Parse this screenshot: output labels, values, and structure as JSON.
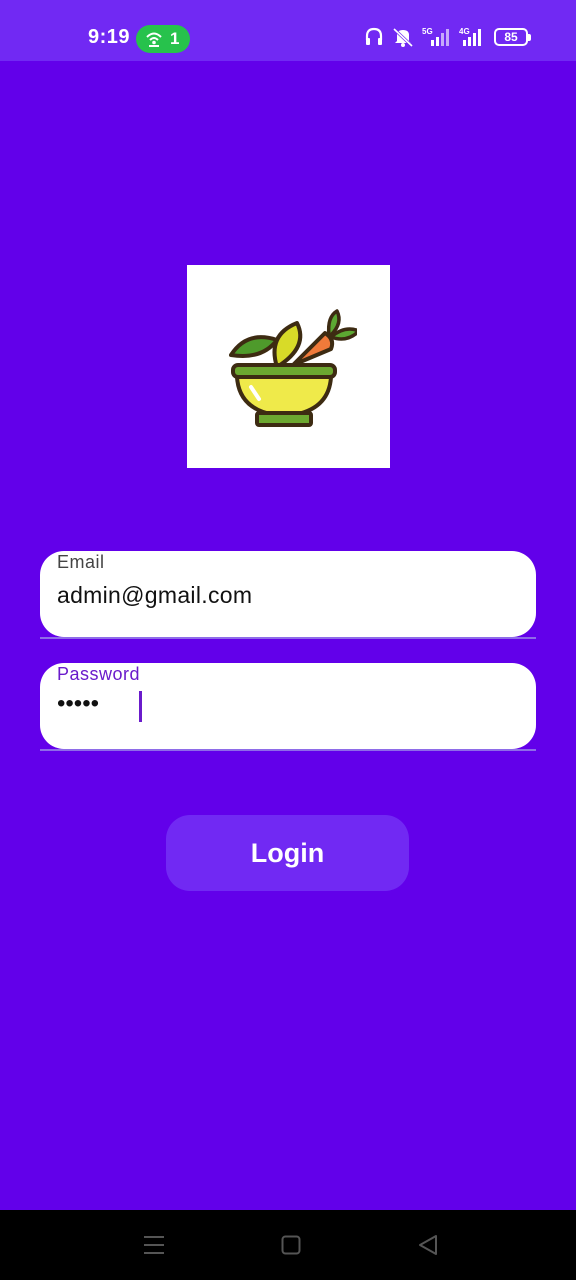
{
  "status_bar": {
    "time": "9:19",
    "hotspot_count": "1",
    "battery_level": "85",
    "icons": [
      "wifi-hotspot-icon",
      "headphones-icon",
      "mute-icon",
      "5g-signal-icon",
      "4g-signal-icon",
      "battery-icon"
    ]
  },
  "logo": {
    "icon": "salad-bowl-icon"
  },
  "form": {
    "email": {
      "label": "Email",
      "value": "admin@gmail.com"
    },
    "password": {
      "label": "Password",
      "value": "•••••"
    },
    "login_label": "Login"
  },
  "nav_bar": {
    "icons": [
      "recent-apps-icon",
      "home-icon",
      "back-icon"
    ]
  },
  "colors": {
    "background": "#6200EA",
    "status_bar": "#7129F3",
    "button": "#7129F3",
    "accent": "#6A1BCB"
  }
}
